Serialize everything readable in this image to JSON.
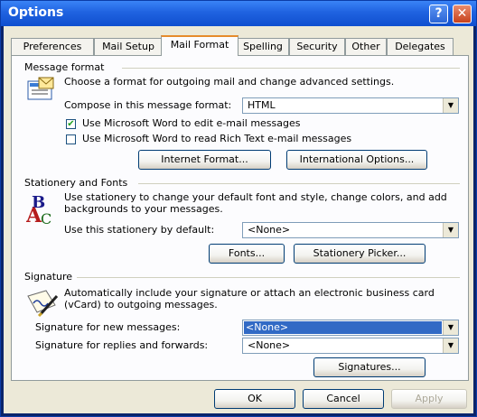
{
  "window": {
    "title": "Options"
  },
  "tabs": [
    {
      "label": "Preferences"
    },
    {
      "label": "Mail Setup"
    },
    {
      "label": "Mail Format"
    },
    {
      "label": "Spelling"
    },
    {
      "label": "Security"
    },
    {
      "label": "Other"
    },
    {
      "label": "Delegates"
    }
  ],
  "message_format": {
    "heading": "Message format",
    "description": "Choose a format for outgoing mail and change advanced settings.",
    "compose_label": "Compose in this message format:",
    "compose_value": "HTML",
    "use_word_edit": "Use Microsoft Word to edit e-mail messages",
    "use_word_edit_checked": true,
    "use_word_read": "Use Microsoft Word to read Rich Text e-mail messages",
    "use_word_read_checked": false,
    "internet_format_button": "Internet Format...",
    "international_options_button": "International Options..."
  },
  "stationery": {
    "heading": "Stationery and Fonts",
    "description": "Use stationery to change your default font and style, change colors, and add backgrounds to your messages.",
    "default_label": "Use this stationery by default:",
    "default_value": "<None>",
    "fonts_button": "Fonts...",
    "picker_button": "Stationery Picker..."
  },
  "signature": {
    "heading": "Signature",
    "description": "Automatically include your signature or attach an electronic business card (vCard) to outgoing messages.",
    "new_label": "Signature for new messages:",
    "new_value": "<None>",
    "reply_label": "Signature for replies and forwards:",
    "reply_value": "<None>",
    "signatures_button": "Signatures..."
  },
  "footer": {
    "ok": "OK",
    "cancel": "Cancel",
    "apply": "Apply"
  }
}
